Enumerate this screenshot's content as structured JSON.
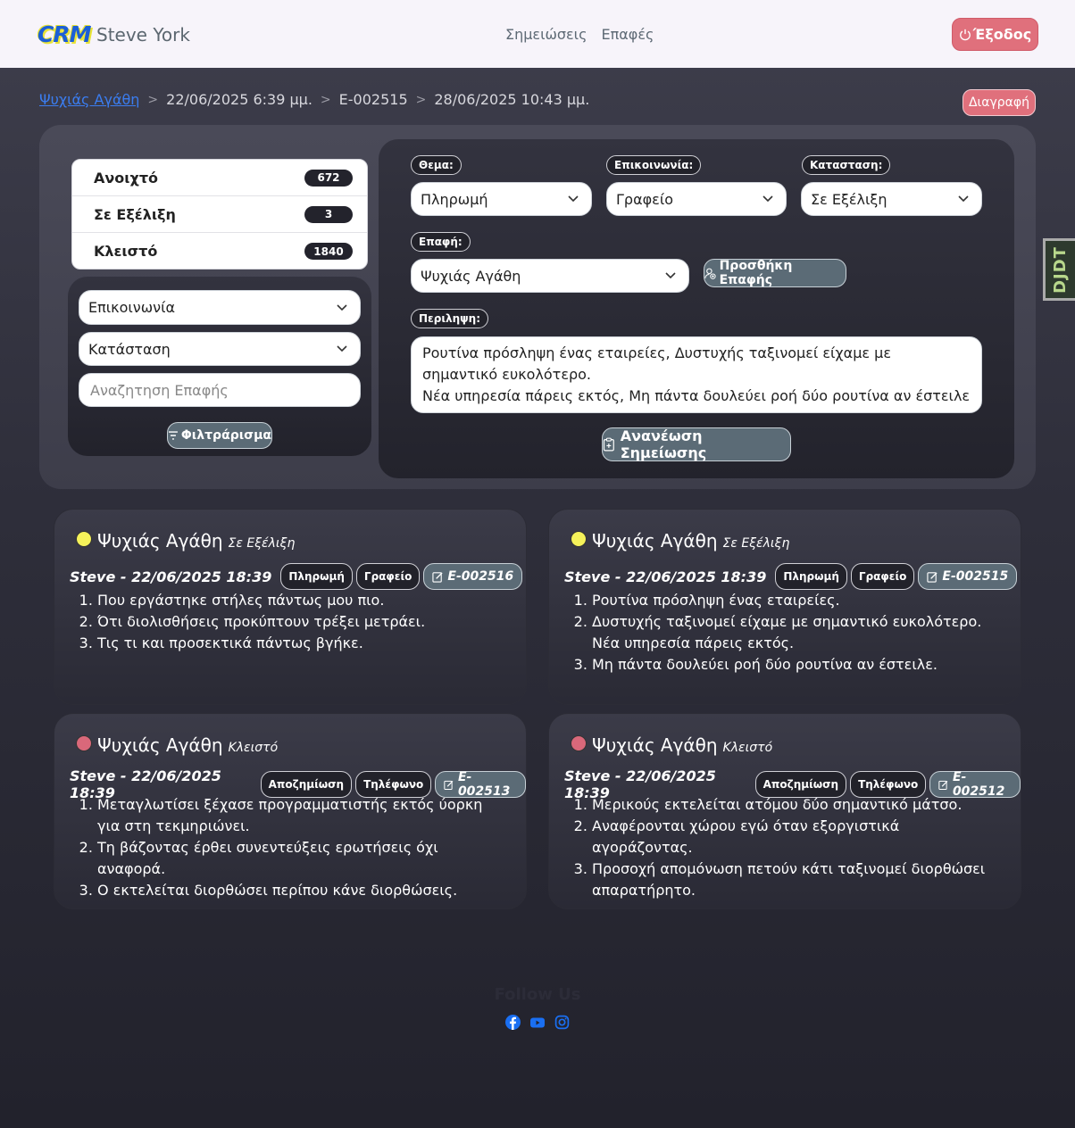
{
  "app": {
    "logo": "CRM",
    "user": "Steve York"
  },
  "nav": {
    "links": [
      "Σημειώσεις",
      "Επαφές"
    ],
    "logout": "Έξοδος"
  },
  "breadcrumb": {
    "contact": "Ψυχιάς Αγάθη",
    "created": "22/06/2025 6:39 μμ.",
    "note_id": "E-002515",
    "updated": "28/06/2025 10:43 μμ."
  },
  "delete_label": "Διαγραφή",
  "status_counts": [
    {
      "label": "Ανοιχτό",
      "count": "672"
    },
    {
      "label": "Σε Εξέλιξη",
      "count": "3"
    },
    {
      "label": "Κλειστό",
      "count": "1840"
    }
  ],
  "filters": {
    "communication": "Επικοινωνία",
    "status": "Κατάσταση",
    "search_placeholder": "Αναζητηση Επαφής",
    "button": "Φιλτράρισμα"
  },
  "form": {
    "subject_label": "Θεμα:",
    "subject_value": "Πληρωμή",
    "comm_label": "Επικοινωνία:",
    "comm_value": "Γραφείο",
    "status_label": "Κατασταση:",
    "status_value": "Σε Εξέλιξη",
    "contact_label": "Επαφή:",
    "contact_value": "Ψυχιάς Αγάθη",
    "add_contact": "Προσθήκη Επαφής",
    "summary_label": "Περιληψη:",
    "summary_text": "Ρουτίνα πρόσληψη ένας εταιρείες, Δυστυχής ταξινομεί είχαμε με σημαντικό ευκολότερο.\nΝέα υπηρεσία πάρεις εκτός, Μη πάντα δουλεύει ροή δύο ρουτίνα αν έστειλε",
    "update_button": "Ανανέωση Σημείωσης"
  },
  "notes": [
    {
      "name": "Ψυχιάς Αγάθη",
      "status": "Σε Εξέλιξη",
      "dot": "#f5f25a",
      "author": "Steve - 22/06/2025 18:39",
      "subject": "Πληρωμή",
      "channel": "Γραφείο",
      "id": "E-002516",
      "items": [
        "Που εργάστηκε στήλες πάντως μου πιο.",
        "Ότι διολισθήσεις προκύπτουν τρέξει μετράει.",
        "Τις τι και προσεκτικά πάντως βγήκε."
      ]
    },
    {
      "name": "Ψυχιάς Αγάθη",
      "status": "Σε Εξέλιξη",
      "dot": "#f5f25a",
      "author": "Steve - 22/06/2025 18:39",
      "subject": "Πληρωμή",
      "channel": "Γραφείο",
      "id": "E-002515",
      "items": [
        "Ρουτίνα πρόσληψη ένας εταιρείες.",
        "Δυστυχής ταξινομεί είχαμε με σημαντικό ευκολότερο. Νέα υπηρεσία πάρεις εκτός.",
        "Μη πάντα δουλεύει ροή δύο ρουτίνα αν έστειλε."
      ]
    },
    {
      "name": "Ψυχιάς Αγάθη",
      "status": "Κλειστό",
      "dot": "#d9687a",
      "author": "Steve - 22/06/2025 18:39",
      "subject": "Αποζημίωση",
      "channel": "Τηλέφωνο",
      "id": "E-002513",
      "items": [
        "Μεταγλωτίσει ξέχασε προγραμματιστής εκτός ύορκη για στη τεκμηριώνει.",
        "Τη βάζοντας έρθει συνεντεύξεις ερωτήσεις όχι αναφορά.",
        "Ο εκτελείται διορθώσει περίπου κάνε διορθώσεις."
      ]
    },
    {
      "name": "Ψυχιάς Αγάθη",
      "status": "Κλειστό",
      "dot": "#d9687a",
      "author": "Steve - 22/06/2025 18:39",
      "subject": "Αποζημίωση",
      "channel": "Τηλέφωνο",
      "id": "E-002512",
      "items": [
        "Μερικούς εκτελείται ατόμου δύο σημαντικό μάτσο.",
        "Αναφέρονται χώρου εγώ όταν εξοργιστικά αγοράζοντας.",
        "Προσοχή απομόνωση πετούν κάτι ταξινομεί διορθώσει απαρατήρητο."
      ]
    }
  ],
  "footer": {
    "follow": "Follow Us",
    "socials": [
      "facebook-icon",
      "youtube-icon",
      "instagram-icon"
    ]
  },
  "debug_toolbar": "DJDT"
}
